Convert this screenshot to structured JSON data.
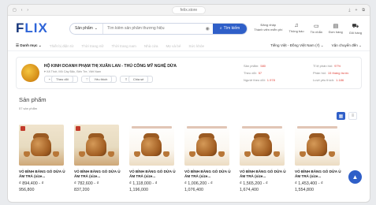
{
  "browser": {
    "url": "felix.store"
  },
  "header": {
    "logo_main": "F",
    "logo_rest": "LIX",
    "search_category": "Sản phẩm",
    "search_placeholder": "Tìm kiếm sản phẩm thương hiệu",
    "search_button": "Tìm kiếm",
    "login_line1": "Đăng nhập",
    "login_line2": "Thành viên miễn phí",
    "icons": [
      {
        "label": "Thông báo",
        "icon": "bell-icon"
      },
      {
        "label": "Tin nhắn",
        "icon": "message-icon"
      },
      {
        "label": "Đơn hàng",
        "icon": "order-icon"
      },
      {
        "label": "Giỏ hàng",
        "icon": "cart-icon"
      }
    ]
  },
  "catbar": {
    "menu_label": "Danh mục",
    "items": [
      "Thiết bị điện tử",
      "Thời trang nữ",
      "Thời trang nam",
      "Nhà cửa",
      "Mẹ và bé",
      "Sức khỏe"
    ],
    "language": "Tiếng Việt - Đồng Việt Nam (₫)",
    "ship_to": "Vận chuyển đến"
  },
  "shop": {
    "name": "HỘ KINH DOANH PHẠM THỊ XUÂN LAN - THỦ CÔNG MỸ NGHỆ DỪA",
    "address": "Xã Thới, Mỏ Cày Bắc, Bến Tre, Việt Nam",
    "follow": "Theo dõi",
    "chat": "Yêu thích",
    "share": "Chia sẻ",
    "stats": [
      {
        "label": "Sản phẩm",
        "value": "580"
      },
      {
        "label": "Tỉ lệ phản hồi",
        "value": "97%"
      },
      {
        "label": "Theo dõi",
        "value": "57"
      },
      {
        "label": "Phản hồi",
        "value": "15 tháng trước"
      },
      {
        "label": "Người theo dõi",
        "value": "1.978"
      },
      {
        "label": "Lượt yêu thích",
        "value": "1.186"
      }
    ]
  },
  "products_section": {
    "title": "Sản phẩm",
    "count_label": "57 sản phẩm"
  },
  "products": [
    {
      "name": "VỎ BÌNH BẰNG GỖ DỪA Ủ ẤM TRÀ (size...",
      "price": "₫ 894,400 - ₫",
      "price_max": "956,800",
      "white": false
    },
    {
      "name": "VỎ BÌNH BẰNG GỖ DỪA Ủ ẤM TRÀ (size...",
      "price": "₫ 782,600 - ₫",
      "price_max": "837,200",
      "white": false
    },
    {
      "name": "VỎ BÌNH BẰNG GỖ DỪA Ủ ẤM TRÀ (size...",
      "price": "₫ 1,118,000 - ₫",
      "price_max": "1,196,000",
      "white": true
    },
    {
      "name": "VỎ BÌNH BẰNG GỖ DỪA Ủ ẤM TRÀ (size...",
      "price": "₫ 1,006,200 - ₫",
      "price_max": "1,076,400",
      "white": true
    },
    {
      "name": "VỎ BÌNH BẰNG GỖ DỪA Ủ ẤM TRÀ (size...",
      "price": "₫ 1,565,200 - ₫",
      "price_max": "1,674,400",
      "white": true
    },
    {
      "name": "VỎ BÌNH BẰNG GỖ DỪA Ủ ẤM TRÀ (size...",
      "price": "₫ 1,453,400 - ₫",
      "price_max": "1,554,800",
      "white": true
    }
  ]
}
